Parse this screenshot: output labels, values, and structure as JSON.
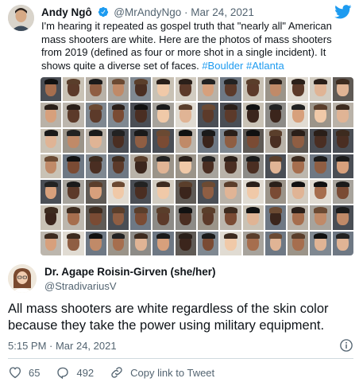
{
  "quoted_tweet": {
    "author_name": "Andy Ngô",
    "handle": "@MrAndyNgo",
    "separator": "·",
    "date": "Mar 24, 2021",
    "text_before": "I'm hearing it repeated as gospel truth that \"nearly all\" American mass shooters are white. Here are the photos of mass shooters from 2019 (defined as four or more shot in a single incident). It shows quite a diverse set of faces. ",
    "hashtag_1": "#Boulder",
    "hashtag_2": "#Atlanta"
  },
  "tweet": {
    "author_name": "Dr. Agape Roisin-Girven (she/her)",
    "handle": "@StradivariusV",
    "text": "All mass shooters are white regardless of the skin color because they take the power using military equipment.",
    "timestamp": "5:15 PM · Mar 24, 2021"
  },
  "actions": {
    "like_count": "65",
    "reply_count": "492",
    "copy_link_label": "Copy link to Tweet"
  },
  "colors": {
    "accent": "#1d9bf0",
    "text_primary": "#0f1419",
    "text_secondary": "#536471",
    "like_icon": "#536471"
  },
  "icons": {
    "verified": "verified-badge-icon",
    "brand": "twitter-bird-icon",
    "info": "info-icon",
    "like": "heart-icon",
    "reply": "speech-bubble-icon",
    "link": "link-icon"
  }
}
